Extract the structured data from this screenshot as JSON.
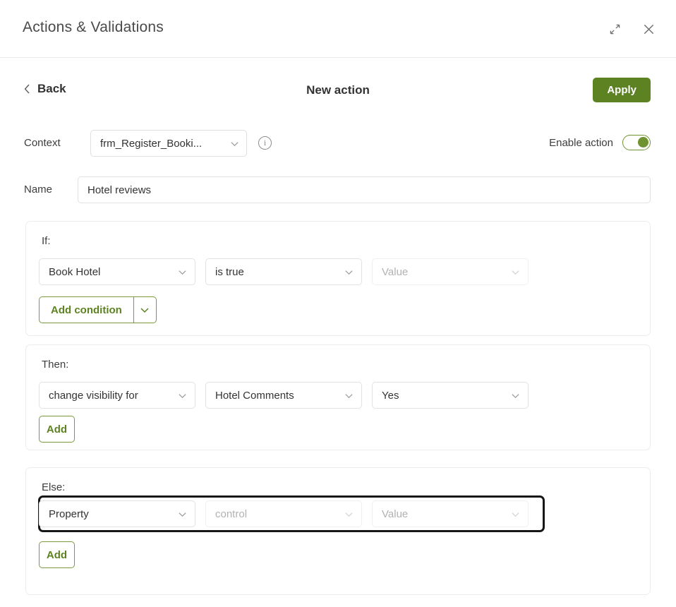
{
  "window": {
    "title": "Actions & Validations",
    "expand_icon": "expand-icon",
    "close_icon": "close-icon"
  },
  "subheader": {
    "back_label": "Back",
    "back_chevron": "chevron-left-icon",
    "page_title": "New action",
    "apply_label": "Apply"
  },
  "context": {
    "label": "Context",
    "value": "frm_Register_Booki...",
    "info_icon": "info-circle-icon",
    "enable_label": "Enable action",
    "enable_state": "on"
  },
  "name": {
    "label": "Name",
    "value": "Hotel reviews",
    "placeholder": "Name"
  },
  "sections": [
    {
      "id": "if",
      "label": "If:",
      "selects": [
        {
          "name": "condition-field-select",
          "value": "Book Hotel",
          "disabled": false
        },
        {
          "name": "condition-operator-select",
          "value": "is true",
          "disabled": false
        },
        {
          "name": "condition-value-select",
          "value": "Value",
          "disabled": true
        }
      ],
      "button": {
        "label": "Add condition",
        "type": "split",
        "caret": "chevron-down-icon"
      }
    },
    {
      "id": "then",
      "label": "Then:",
      "selects": [
        {
          "name": "then-action-select",
          "value": "change visibility for",
          "disabled": false
        },
        {
          "name": "then-target-select",
          "value": "Hotel Comments",
          "disabled": false
        },
        {
          "name": "then-value-select",
          "value": "Yes",
          "disabled": false
        }
      ],
      "button": {
        "label": "Add",
        "type": "plain"
      }
    },
    {
      "id": "else",
      "label": "Else:",
      "focused": true,
      "selects": [
        {
          "name": "else-action-select",
          "value": "Property",
          "disabled": false
        },
        {
          "name": "else-target-select",
          "value": "control",
          "disabled": true
        },
        {
          "name": "else-value-select",
          "value": "Value",
          "disabled": true
        }
      ],
      "button": {
        "label": "Add",
        "type": "plain"
      }
    }
  ],
  "colors": {
    "accent_green": "#5d8222",
    "outline_green": "#7a9a3d",
    "focus_outline": "#161616",
    "border_grey": "#e2e2e2",
    "text_dark": "#333333"
  }
}
